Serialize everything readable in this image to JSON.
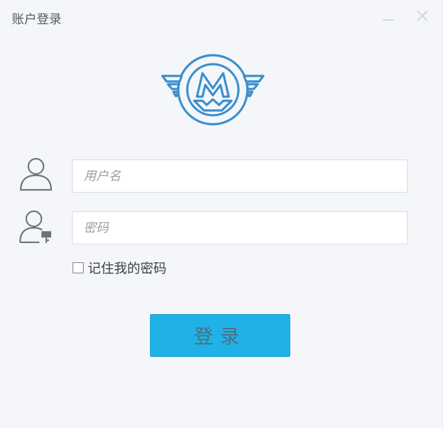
{
  "window": {
    "title": "账户登录",
    "minimize_icon": "minimize-icon",
    "close_icon": "close-icon"
  },
  "logo": {
    "icon": "winged-m-logo",
    "color": "#3a8fcc"
  },
  "username": {
    "placeholder": "用户名",
    "value": "",
    "icon": "user-icon"
  },
  "password": {
    "placeholder": "密码",
    "value": "",
    "icon": "user-lock-icon"
  },
  "remember": {
    "label": "记住我的密码",
    "checked": false
  },
  "login_button": {
    "label": "登录",
    "color": "#20b2e6"
  }
}
